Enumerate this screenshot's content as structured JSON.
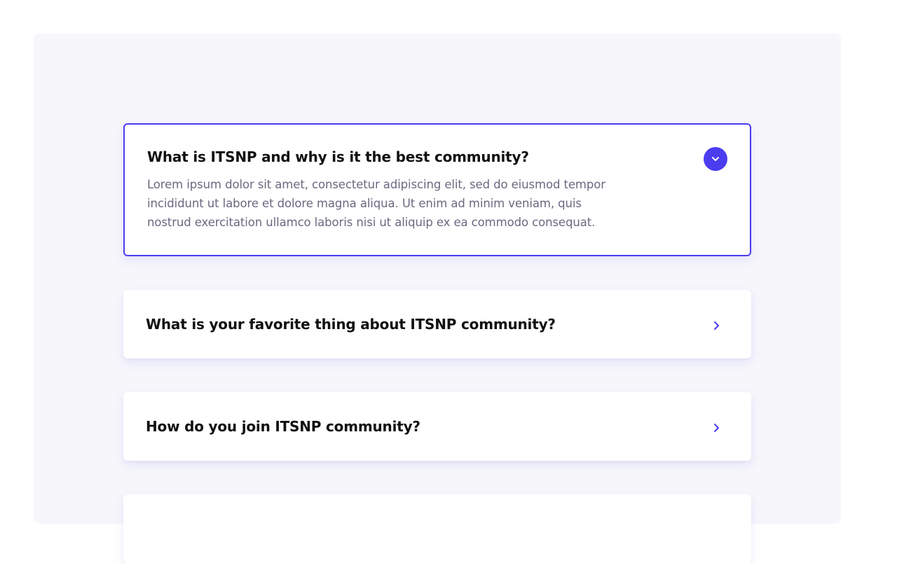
{
  "faq": {
    "items": [
      {
        "question": "What is ITSNP and why is it the best community?",
        "answer": "Lorem ipsum dolor sit amet, consectetur adipiscing elit, sed do eiusmod tempor incididunt ut labore et dolore magna aliqua. Ut enim ad minim veniam, quis nostrud exercitation ullamco laboris nisi ut aliquip ex ea commodo consequat.",
        "expanded": true
      },
      {
        "question": "What is your favorite thing about ITSNP community?",
        "expanded": false
      },
      {
        "question": "How do you join ITSNP community?",
        "expanded": false
      },
      {
        "question": "",
        "expanded": false
      }
    ],
    "icons": {
      "expanded": "chevron-down-icon",
      "collapsed": "chevron-right-icon"
    }
  },
  "colors": {
    "accent": "#4b3cf0",
    "panel_bg": "#f6f6fb",
    "question_text": "#111111",
    "answer_text": "#6b6880"
  }
}
